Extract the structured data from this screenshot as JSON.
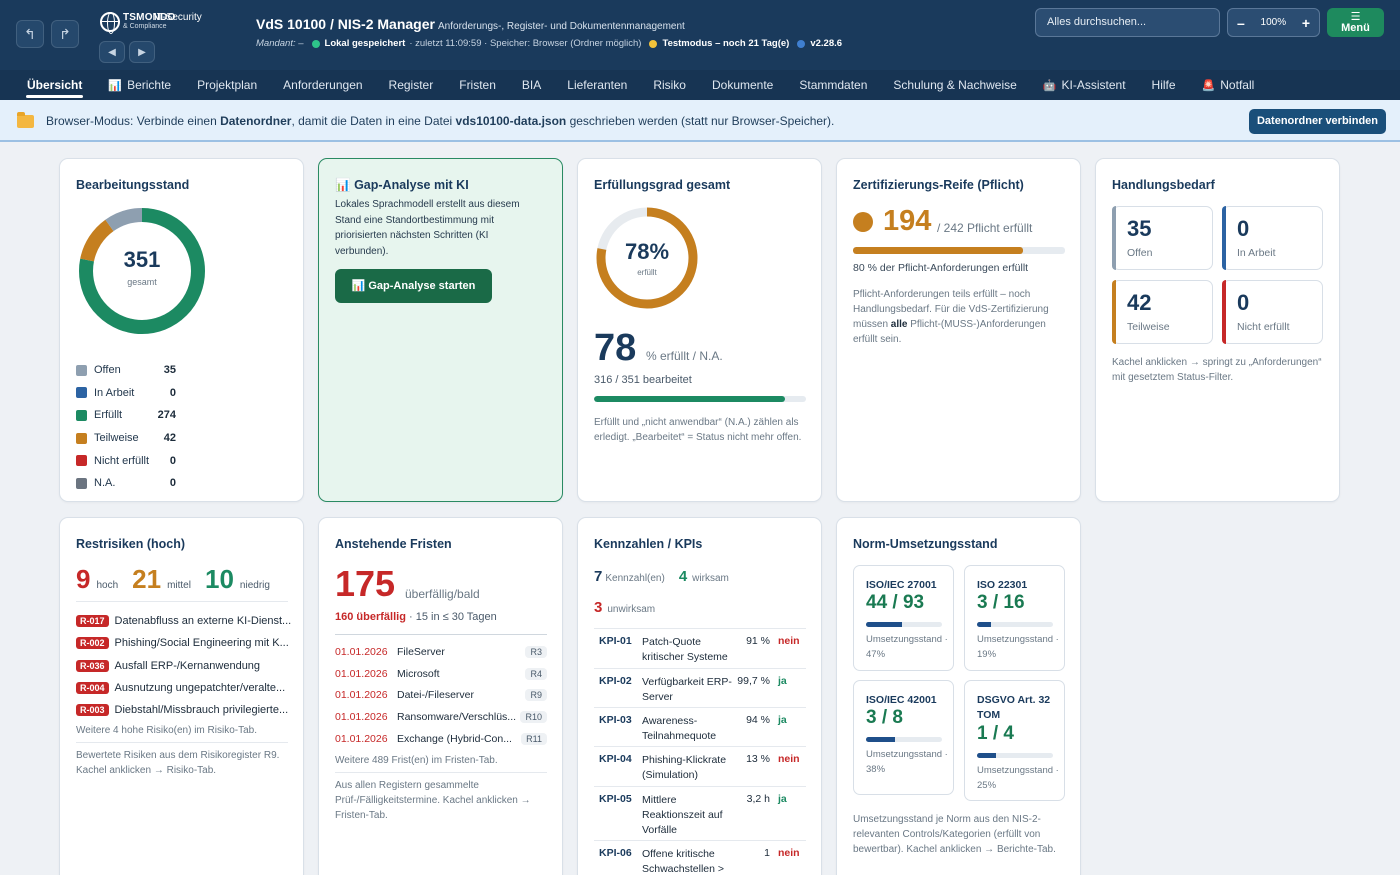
{
  "header": {
    "brand_name": "TSMONDO",
    "brand_suffix": "IT-Security",
    "brand_small": "& Compliance",
    "app_title": "VdS 10100 / NIS-2 Manager",
    "app_subtitle": "Anforderungs-, Register- und Dokumentenmanagement",
    "mandant": "Mandant: –",
    "status_saved": "Lokal gespeichert",
    "status_last": "· zuletzt 11:09:59 · Speicher: Browser (Ordner möglich)",
    "status_test": "Testmodus – noch 21 Tag(e)",
    "version": "v2.28.6",
    "search_placeholder": "Alles durchsuchen...",
    "zoom_minus": "–",
    "zoom_value": "100%",
    "zoom_plus": "+",
    "menu_icon": "☰",
    "menu_label": "Menü",
    "back_icon": "↰",
    "forward_icon": "↱",
    "prev_icon": "◀",
    "next_icon": "▶"
  },
  "tabs": [
    {
      "label": "Übersicht",
      "icon": ""
    },
    {
      "label": "Berichte",
      "icon": "📊"
    },
    {
      "label": "Projektplan",
      "icon": ""
    },
    {
      "label": "Anforderungen",
      "icon": ""
    },
    {
      "label": "Register",
      "icon": ""
    },
    {
      "label": "Fristen",
      "icon": ""
    },
    {
      "label": "BIA",
      "icon": ""
    },
    {
      "label": "Lieferanten",
      "icon": ""
    },
    {
      "label": "Risiko",
      "icon": ""
    },
    {
      "label": "Dokumente",
      "icon": ""
    },
    {
      "label": "Stammdaten",
      "icon": ""
    },
    {
      "label": "Schulung & Nachweise",
      "icon": ""
    },
    {
      "label": "KI-Assistent",
      "icon": "🤖"
    },
    {
      "label": "Hilfe",
      "icon": ""
    },
    {
      "label": "Notfall",
      "icon": "🚨"
    }
  ],
  "banner": {
    "t1": "Browser-Modus: Verbinde einen ",
    "b1": "Datenordner",
    "t2": ", damit die Daten in eine Datei ",
    "b2": "vds10100-data.json",
    "t3": " geschrieben werden (statt nur Browser-Speicher).",
    "button": "Datenordner verbinden"
  },
  "colors": {
    "offen": "#8e9fb0",
    "in_arbeit": "#2c63a3",
    "erfuellt": "#1c8a62",
    "teilweise": "#c57f1f",
    "nicht_erfuellt": "#c62828",
    "na": "#6b7480"
  },
  "bearbeitung": {
    "title": "Bearbeitungsstand",
    "total": "351",
    "total_label": "gesamt",
    "items": [
      {
        "label": "Offen",
        "value": "35"
      },
      {
        "label": "In Arbeit",
        "value": "0"
      },
      {
        "label": "Erfüllt",
        "value": "274"
      },
      {
        "label": "Teilweise",
        "value": "42"
      },
      {
        "label": "Nicht erfüllt",
        "value": "0"
      },
      {
        "label": "N.A.",
        "value": "0"
      }
    ]
  },
  "gap": {
    "icon": "📊",
    "title": "Gap-Analyse mit KI",
    "text": "Lokales Sprachmodell erstellt aus diesem Stand eine Standortbestimmung mit priorisierten nächsten Schritten (KI verbunden).",
    "button": "📊 Gap-Analyse starten"
  },
  "erfuellung": {
    "title": "Erfüllungsgrad gesamt",
    "ring_percent": "78%",
    "ring_label": "erfüllt",
    "big": "78",
    "big_suffix": "% erfüllt / N.A.",
    "sub": "316 / 351 bearbeitet",
    "progress": 0.9,
    "note": "Erfüllt und „nicht anwendbar“ (N.A.) zählen als erledigt. „Bearbeitet“ = Status nicht mehr offen."
  },
  "reife": {
    "title": "Zertifizierungs-Reife (Pflicht)",
    "big": "194",
    "suffix": "/ 242 Pflicht erfüllt",
    "progress": 0.8,
    "sub": "80 % der Pflicht-Anforderungen erfüllt",
    "note1": "Pflicht-Anforderungen teils erfüllt – noch Handlungsbedarf. Für die VdS-Zertifizierung müssen ",
    "note_bold": "alle",
    "note2": " Pflicht-(MUSS-)Anforderungen erfüllt sein."
  },
  "handlung": {
    "title": "Handlungsbedarf",
    "tiles": [
      {
        "value": "35",
        "label": "Offen"
      },
      {
        "value": "0",
        "label": "In Arbeit"
      },
      {
        "value": "42",
        "label": "Teilweise"
      },
      {
        "value": "0",
        "label": "Nicht erfüllt"
      }
    ],
    "note": "Kachel anklicken → springt zu „Anforderungen“ mit gesetztem Status-Filter."
  },
  "restrisiken": {
    "title": "Restrisiken (hoch)",
    "hoch": "9",
    "hoch_label": "hoch",
    "mittel": "21",
    "mittel_label": "mittel",
    "niedrig": "10",
    "niedrig_label": "niedrig",
    "items": [
      {
        "id": "R-017",
        "text": "Datenabfluss an externe KI-Dienst..."
      },
      {
        "id": "R-002",
        "text": "Phishing/Social Engineering mit K..."
      },
      {
        "id": "R-036",
        "text": "Ausfall ERP-/Kernanwendung"
      },
      {
        "id": "R-004",
        "text": "Ausnutzung ungepatchter/veralte..."
      },
      {
        "id": "R-003",
        "text": "Diebstahl/Missbrauch privilegierte..."
      }
    ],
    "more": "Weitere 4 hohe Risiko(en) im Risiko-Tab.",
    "note": "Bewertete Risiken aus dem Risikoregister R9. Kachel anklicken → Risiko-Tab."
  },
  "fristen": {
    "title": "Anstehende Fristen",
    "big": "175",
    "big_suffix": "überfällig/bald",
    "overdue": "160 überfällig",
    "soon": "· 15 in ≤ 30 Tagen",
    "items": [
      {
        "date": "01.01.2026",
        "name": "FileServer",
        "reg": "R3"
      },
      {
        "date": "01.01.2026",
        "name": "Microsoft",
        "reg": "R4"
      },
      {
        "date": "01.01.2026",
        "name": "Datei-/Fileserver",
        "reg": "R9"
      },
      {
        "date": "01.01.2026",
        "name": "Ransomware/Verschlüs...",
        "reg": "R10"
      },
      {
        "date": "01.01.2026",
        "name": "Exchange (Hybrid-Con...",
        "reg": "R11"
      }
    ],
    "more": "Weitere 489 Frist(en) im Fristen-Tab.",
    "note": "Aus allen Registern gesammelte Prüf-/Fälligkeitstermine. Kachel anklicken → Fristen-Tab."
  },
  "kpis": {
    "title": "Kennzahlen / KPIs",
    "count": "7",
    "count_label": "Kennzahl(en)",
    "wirksam": "4",
    "wirksam_label": "wirksam",
    "unwirksam": "3",
    "unwirksam_label": "unwirksam",
    "rows": [
      {
        "id": "KPI-01",
        "name": "Patch-Quote kritischer Systeme",
        "value": "91 %",
        "status": "nein"
      },
      {
        "id": "KPI-02",
        "name": "Verfügbarkeit ERP-Server",
        "value": "99,7 %",
        "status": "ja"
      },
      {
        "id": "KPI-03",
        "name": "Awareness-Teilnahmequote",
        "value": "94 %",
        "status": "ja"
      },
      {
        "id": "KPI-04",
        "name": "Phishing-Klickrate (Simulation)",
        "value": "13 %",
        "status": "nein"
      },
      {
        "id": "KPI-05",
        "name": "Mittlere Reaktionszeit auf Vorfälle",
        "value": "3,2 h",
        "status": "ja"
      },
      {
        "id": "KPI-06",
        "name": "Offene kritische Schwachstellen >",
        "value": "1",
        "status": "nein"
      }
    ]
  },
  "norm": {
    "title": "Norm-Umsetzungsstand",
    "items": [
      {
        "name": "ISO/IEC 27001",
        "value": "44 / 93",
        "label": "Umsetzungsstand · 47%",
        "fraction": 0.47
      },
      {
        "name": "ISO 22301",
        "value": "3 / 16",
        "label": "Umsetzungsstand · 19%",
        "fraction": 0.19
      },
      {
        "name": "ISO/IEC 42001",
        "value": "3 / 8",
        "label": "Umsetzungsstand · 38%",
        "fraction": 0.38
      },
      {
        "name": "DSGVO Art. 32 TOM",
        "value": "1 / 4",
        "label": "Umsetzungsstand · 25%",
        "fraction": 0.25
      }
    ],
    "note": "Umsetzungsstand je Norm aus den NIS-2-relevanten Controls/Kategorien (erfüllt von bewertbar). Kachel anklicken → Berichte-Tab."
  }
}
